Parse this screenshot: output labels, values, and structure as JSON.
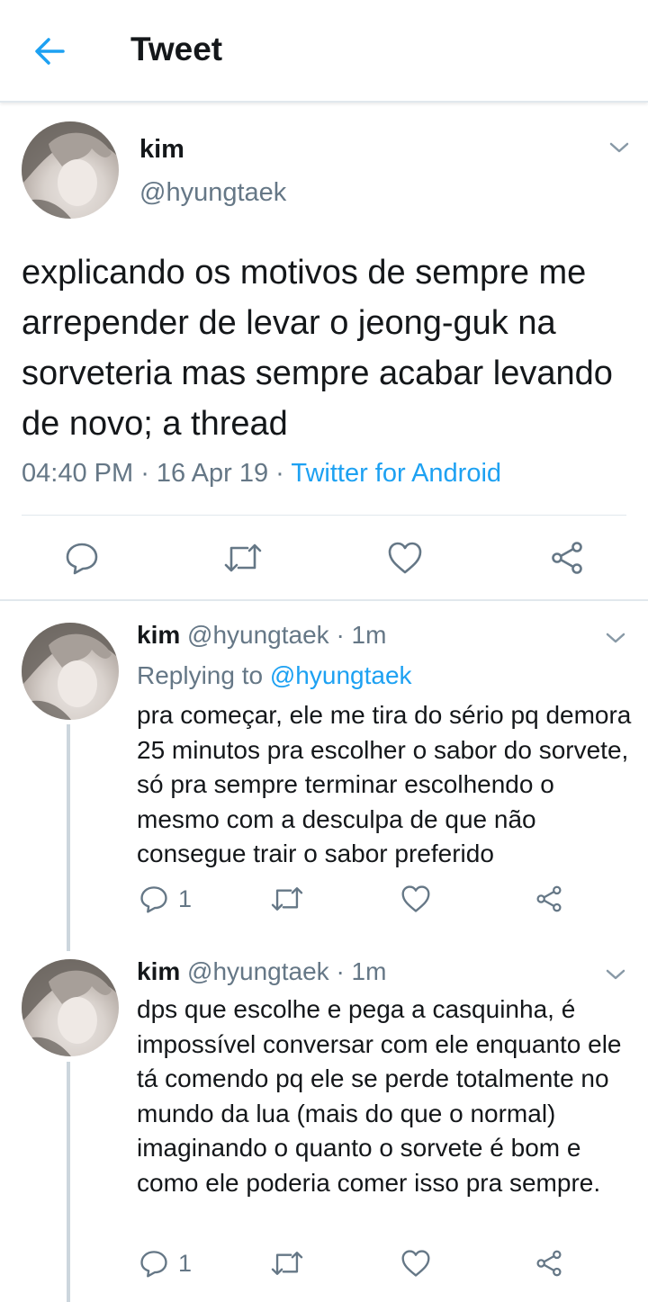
{
  "header": {
    "title": "Tweet",
    "back_icon": "arrow-left-icon",
    "accent": "#1da1f2"
  },
  "main_tweet": {
    "name": "kim",
    "handle": "@hyungtaek",
    "text": "explicando os motivos de sempre me arrepender de levar o jeong-guk na sorveteria mas sempre acabar levando de novo; a thread",
    "time": "04:40 PM",
    "sep1": " · ",
    "date": "16 Apr 19",
    "sep2": " · ",
    "source": "Twitter for Android"
  },
  "replies": [
    {
      "name": "kim",
      "handle": "@hyungtaek",
      "time": " · 1m",
      "replying_label": "Replying to ",
      "replying_handle": "@hyungtaek",
      "text": "pra começar, ele me tira do sério pq demora 25 minutos pra escolher o sabor do sorvete, só pra sempre terminar escolhendo o mesmo com a desculpa de que não consegue trair o sabor preferido",
      "reply_count": "1"
    },
    {
      "name": "kim",
      "handle": "@hyungtaek",
      "time": " · 1m",
      "text": "dps que escolhe e pega a casquinha, é impossível conversar com ele enquanto ele tá comendo pq ele se perde totalmente no mundo da lua (mais do que o normal) imaginando o quanto o sorvete é bom e como ele poderia comer isso pra sempre.",
      "reply_count": "1"
    }
  ],
  "colors": {
    "text": "#14171a",
    "secondary": "#657786",
    "link": "#1da1f2",
    "divider": "#e1e8ed",
    "icon": "#657786"
  }
}
